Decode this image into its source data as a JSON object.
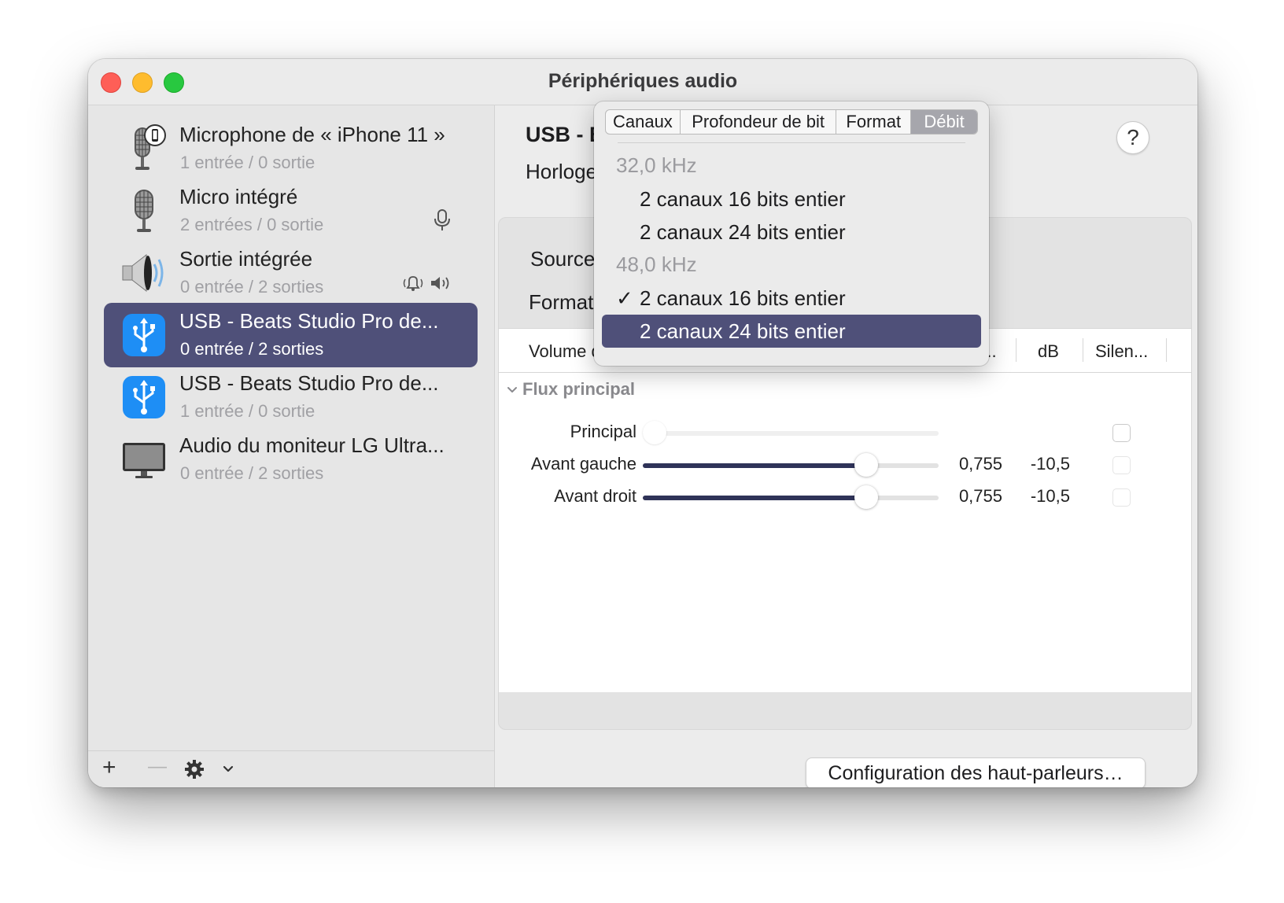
{
  "window": {
    "title": "Périphériques audio"
  },
  "sidebar": {
    "devices": [
      {
        "name": "Microphone de « iPhone 11 »",
        "io": "1 entrée / 0 sortie",
        "icon": "iphone-microphone-icon"
      },
      {
        "name": "Micro intégré",
        "io": "2 entrées / 0 sortie",
        "icon": "microphone-icon",
        "badge": "default-input-mic-icon"
      },
      {
        "name": "Sortie intégrée",
        "io": "0 entrée / 2 sorties",
        "icon": "speaker-icon",
        "badge": "default-alert-and-output-icons"
      },
      {
        "name": "USB - Beats Studio Pro de...",
        "io": "0 entrée / 2 sorties",
        "icon": "usb-icon",
        "selected": true
      },
      {
        "name": "USB - Beats Studio Pro de...",
        "io": "1 entrée / 0 sortie",
        "icon": "usb-icon"
      },
      {
        "name": "Audio du moniteur LG Ultra...",
        "io": "0 entrée / 2 sorties",
        "icon": "monitor-icon"
      }
    ],
    "toolbar": {
      "add": "+",
      "remove": "—",
      "gear": "gear-icon",
      "chevron": "chevron-down-icon"
    }
  },
  "main": {
    "device_title": "USB - B",
    "clock_label": "Horloge",
    "help_label": "?",
    "source_label": "Source",
    "format_label": "Format",
    "columns": {
      "volume": "Volume d",
      "value": "e...",
      "db": "dB",
      "mute": "Silen..."
    },
    "group_label": "Flux principal",
    "rows": [
      {
        "label": "Principal",
        "level": 0.0,
        "value": "",
        "db": "",
        "enabled": false
      },
      {
        "label": "Avant gauche",
        "level": 0.755,
        "value": "0,755",
        "db": "-10,5",
        "enabled": true
      },
      {
        "label": "Avant droit",
        "level": 0.755,
        "value": "0,755",
        "db": "-10,5",
        "enabled": true
      }
    ],
    "speaker_button": "Configuration des haut-parleurs…"
  },
  "popup": {
    "segments": [
      "Canaux",
      "Profondeur de bit",
      "Format",
      "Débit"
    ],
    "active_segment": "Débit",
    "items": [
      {
        "type": "header",
        "text": "32,0 kHz"
      },
      {
        "type": "item",
        "text": "2 canaux 16 bits entier"
      },
      {
        "type": "item",
        "text": "2 canaux 24 bits entier"
      },
      {
        "type": "header",
        "text": "48,0 kHz"
      },
      {
        "type": "item",
        "text": "2 canaux 16 bits entier",
        "checked": true,
        "check": "✓"
      },
      {
        "type": "item",
        "text": "2 canaux 24 bits entier",
        "highlighted": true
      }
    ]
  },
  "colors": {
    "selection": "#4f5079",
    "slider_fill": "#2f3358"
  }
}
